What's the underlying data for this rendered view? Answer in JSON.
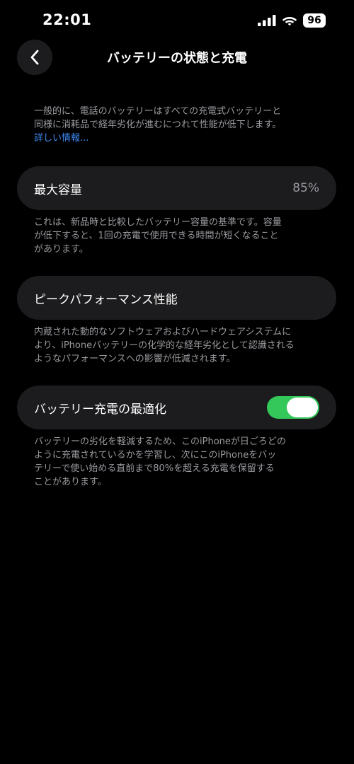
{
  "status_bar": {
    "time": "22:01",
    "battery_level": "96",
    "icons": [
      "signal-icon",
      "wifi-icon",
      "battery-icon"
    ]
  },
  "nav": {
    "back_icon": "chevron-left-icon",
    "title": "バッテリーの状態と充電"
  },
  "intro": {
    "text_line1": "一般的に、電話のバッテリーはすべての充電式バッテリーと",
    "text_line2": "同様に消耗品で経年劣化が進むにつれて性能が低下します。",
    "learn_more": "詳しい情報..."
  },
  "max_capacity": {
    "label": "最大容量",
    "value": "85%",
    "footnote_line1": "これは、新品時と比較したバッテリー容量の基準です。容量",
    "footnote_line2": "が低下すると、1回の充電で使用できる時間が短くなること",
    "footnote_line3": "があります。"
  },
  "peak_performance": {
    "label": "ピークパフォーマンス性能",
    "footnote_line1": "内蔵された動的なソフトウェアおよびハードウェアシステムに",
    "footnote_line2": "より、iPhoneバッテリーの化学的な経年劣化として認識される",
    "footnote_line3": "ようなパフォーマンスへの影響が低減されます。"
  },
  "optimized_charging": {
    "label": "バッテリー充電の最適化",
    "enabled": true,
    "footnote_line1": "バッテリーの劣化を軽減するため、このiPhoneが日ごろどの",
    "footnote_line2": "ように充電されているかを学習し、次にこのiPhoneをバッ",
    "footnote_line3": "テリーで使い始める直前まで80%を超える充電を保留する",
    "footnote_line4": "ことがあります。"
  },
  "colors": {
    "background": "#000000",
    "row_background": "#1c1c1e",
    "toggle_on": "#34c759",
    "link": "#3d8bf5",
    "secondary_text": "#9a9aa0"
  }
}
